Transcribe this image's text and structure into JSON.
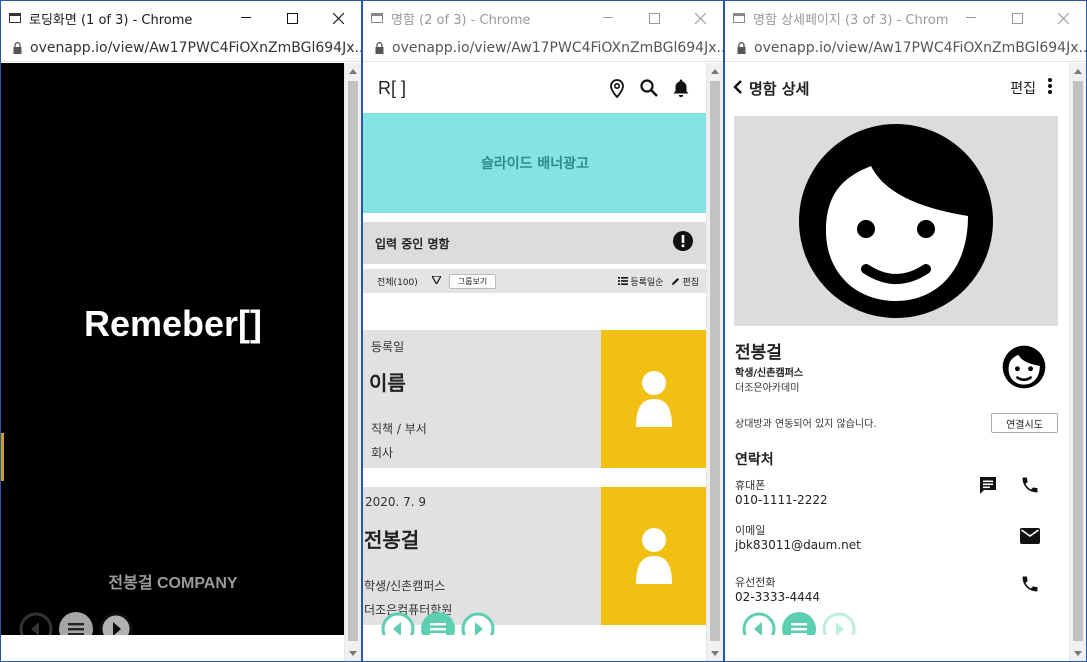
{
  "windows": [
    {
      "title": "로딩화면 (1 of 3) - Chrome",
      "url": "ovenapp.io/view/Aw17PWC4FiOXnZmBGl694Jx...",
      "active": true,
      "brand": "Remeber[]",
      "company": "전봉걸 COMPANY"
    },
    {
      "title": "명함 (2 of 3) - Chrome",
      "url": "ovenapp.io/view/Aw17PWC4FiOXnZmBGl694Jx...",
      "active": false,
      "logo": "R[ ]",
      "banner": "슬라이드 배너광고",
      "input_label": "입력 중인 명함",
      "filter": {
        "all": "전체(100)",
        "group": "그룹보기",
        "sort": "등록일순",
        "edit": "편집"
      },
      "cards": [
        {
          "date": "등록일",
          "name": "이름",
          "position": "직책 / 부서",
          "company": "회사"
        },
        {
          "date": "2020. 7. 9",
          "name": "전봉걸",
          "position": "학생/신촌캠퍼스",
          "company": "더조은컴퓨터학원"
        }
      ]
    },
    {
      "title": "명함 상세페이지 (3 of 3) - Chrome",
      "url": "ovenapp.io/view/Aw17PWC4FiOXnZmBGl694Jx...",
      "active": false,
      "header_title": "명함 상세",
      "edit": "편집",
      "name": "전봉걸",
      "dept": "학생/신촌캠퍼스",
      "org": "더조은아카데미",
      "link_message": "상대방과 연동되어 있지 않습니다.",
      "link_button": "연결시도",
      "contact_title": "연락처",
      "contacts": [
        {
          "label": "휴대폰",
          "value": "010-1111-2222"
        },
        {
          "label": "이메일",
          "value": "jbk83011@daum.net"
        },
        {
          "label": "유선전화",
          "value": "02-3333-4444"
        }
      ]
    }
  ],
  "colors": {
    "teal_accent": "#5ccfb0",
    "banner": "#86e3e3",
    "card_photo": "#f2c012"
  },
  "icons": [
    "location-icon",
    "search-icon",
    "bell-icon",
    "alert-icon",
    "message-icon",
    "phone-icon",
    "mail-icon",
    "more-vert-icon",
    "back-icon",
    "person-icon"
  ]
}
